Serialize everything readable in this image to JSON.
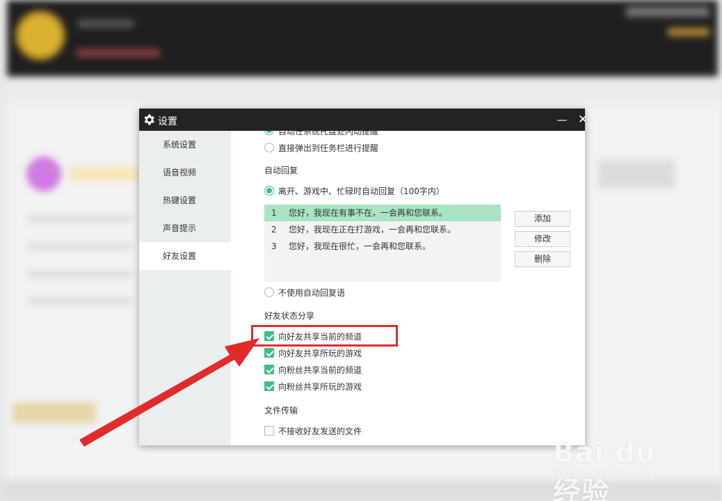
{
  "dialog": {
    "title": "设置",
    "minimize_glyph": "—",
    "close_glyph": "✕"
  },
  "sidebar": {
    "items": [
      {
        "label": "系统设置"
      },
      {
        "label": "语音视频"
      },
      {
        "label": "热键设置"
      },
      {
        "label": "声音提示"
      },
      {
        "label": "好友设置",
        "active": true
      }
    ]
  },
  "message_alert": {
    "option_partial": "自动任系统托盘处闪动提醒",
    "option_taskbar": "直接弹出到任务栏进行提醒"
  },
  "auto_reply": {
    "heading": "自动回复",
    "enable_label": "离开、游戏中、忙碌时自动回复（100字内）",
    "replies": [
      {
        "num": "1",
        "text": "您好，我现在有事不在，一会再和您联系。",
        "selected": true
      },
      {
        "num": "2",
        "text": "您好，我现在正在打游戏，一会再和您联系。"
      },
      {
        "num": "3",
        "text": "您好，我现在很忙，一会再和您联系。"
      }
    ],
    "add_label": "添加",
    "edit_label": "修改",
    "delete_label": "删除",
    "disable_label": "不使用自动回复语"
  },
  "status_share": {
    "heading": "好友状态分享",
    "options": [
      {
        "label": "向好友共享当前的频道",
        "checked": true
      },
      {
        "label": "向好友共享所玩的游戏",
        "checked": true
      },
      {
        "label": "向粉丝共享当前的频道",
        "checked": true
      },
      {
        "label": "向粉丝共享所玩的游戏",
        "checked": true
      }
    ]
  },
  "file_transfer": {
    "heading": "文件传输",
    "reject_label": "不接收好友发送的文件",
    "reject_checked": false
  },
  "watermark": {
    "logo_text": "Bai du 经验",
    "url": "jingyan.baidu.com"
  },
  "colors": {
    "accent_green": "#3dbf84",
    "selected_row": "#a9e4c3",
    "titlebar": "#232323",
    "annotation_red": "#e12b2b"
  }
}
